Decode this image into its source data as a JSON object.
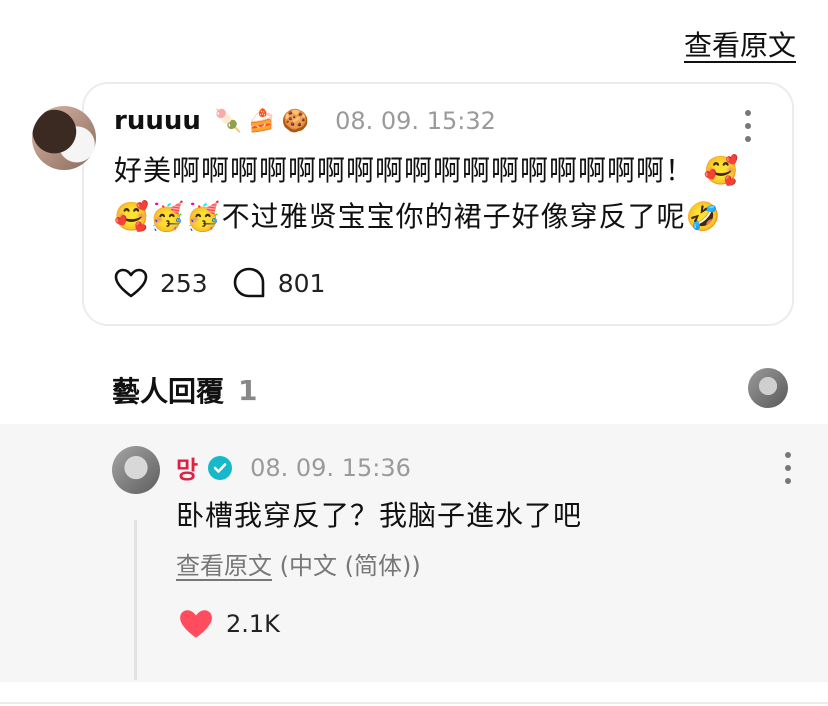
{
  "header": {
    "view_original": "查看原文"
  },
  "post": {
    "username": "ruuuu",
    "username_emojis": [
      "🍡",
      "🍰",
      "🍪"
    ],
    "timestamp": "08. 09. 15:32",
    "text": "好美啊啊啊啊啊啊啊啊啊啊啊啊啊啊啊啊啊！ 🥰🥰🥳🥳不过雅贤宝宝你的裙子好像穿反了呢🤣",
    "likes": "253",
    "comments": "801",
    "icons": {
      "like": "heart-outline-icon",
      "comment": "speech-bubble-icon",
      "more": "more-vertical-icon"
    }
  },
  "artist_replies": {
    "title": "藝人回覆",
    "count": "1"
  },
  "reply": {
    "name": "망",
    "verified": true,
    "timestamp": "08. 09. 15:36",
    "text": "卧槽我穿反了？我脑子進水了吧",
    "translate_link": "查看原文",
    "translate_lang": "(中文 (简体))",
    "likes": "2.1K",
    "colors": {
      "name": "#e02040",
      "verified": "#16b9c9",
      "heart": "#ff4d5e"
    }
  }
}
